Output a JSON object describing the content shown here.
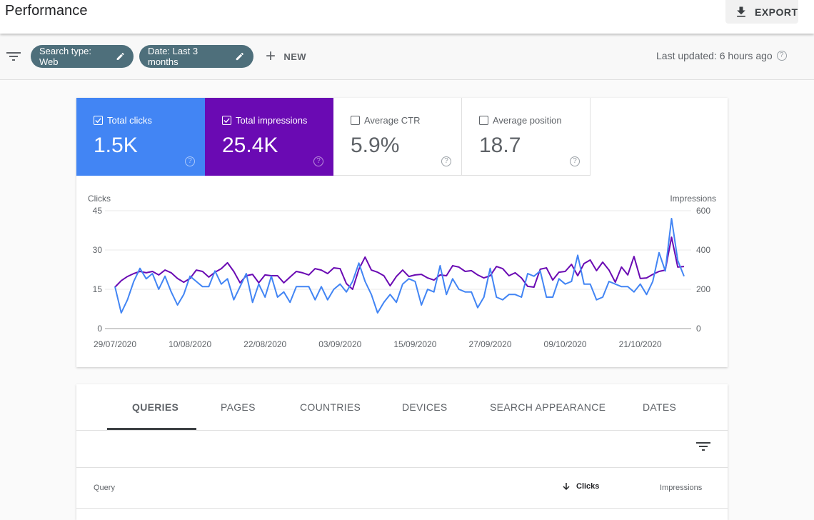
{
  "header": {
    "title": "Performance",
    "export_label": "EXPORT"
  },
  "filters": {
    "chips": [
      {
        "label": "Search type: Web"
      },
      {
        "label": "Date: Last 3 months"
      }
    ],
    "new_label": "NEW",
    "last_updated": "Last updated: 6 hours ago"
  },
  "metrics": [
    {
      "label": "Total clicks",
      "value": "1.5K",
      "checked": true,
      "color": "#4285f4"
    },
    {
      "label": "Total impressions",
      "value": "25.4K",
      "checked": true,
      "color": "#6a0ab3"
    },
    {
      "label": "Average CTR",
      "value": "5.9%",
      "checked": false
    },
    {
      "label": "Average position",
      "value": "18.7",
      "checked": false
    }
  ],
  "chart_data": {
    "type": "line",
    "left_axis_label": "Clicks",
    "right_axis_label": "Impressions",
    "left_ticks": [
      "0",
      "15",
      "30",
      "45"
    ],
    "right_ticks": [
      "0",
      "200",
      "400",
      "600"
    ],
    "left_ylim": [
      0,
      45
    ],
    "right_ylim": [
      0,
      600
    ],
    "x_tick_labels": [
      "29/07/2020",
      "10/08/2020",
      "22/08/2020",
      "03/09/2020",
      "15/09/2020",
      "27/09/2020",
      "09/10/2020",
      "21/10/2020"
    ],
    "x_start": "29/07/2020",
    "x_end": "28/10/2020",
    "grid": true,
    "series": [
      {
        "name": "Clicks",
        "axis": "left",
        "color": "#4285f4",
        "values": [
          16,
          6,
          11,
          18,
          23,
          19,
          21,
          15,
          20,
          14,
          9,
          13,
          20,
          18,
          16,
          16,
          22,
          17,
          19,
          11,
          16,
          21,
          10,
          17,
          12,
          20,
          12,
          14,
          10,
          16,
          16,
          16,
          11,
          16,
          11,
          15,
          17,
          14,
          18,
          25,
          18,
          13,
          6,
          10,
          13,
          10,
          17,
          19,
          18,
          9,
          15,
          14,
          24,
          13,
          19,
          15,
          14,
          14,
          8,
          12,
          23,
          12,
          11,
          13,
          13,
          12,
          21,
          20,
          22,
          12,
          12,
          19,
          17,
          18,
          28,
          17,
          17,
          11,
          12,
          18,
          17,
          16,
          16,
          14,
          17,
          13,
          18,
          29,
          22,
          42,
          26,
          20
        ]
      },
      {
        "name": "Impressions",
        "axis": "right",
        "color": "#6a0ab3",
        "values": [
          211,
          244,
          265,
          280,
          291,
          284,
          291,
          273,
          298,
          284,
          255,
          236,
          255,
          298,
          291,
          262,
          287,
          305,
          335,
          291,
          233,
          269,
          276,
          233,
          273,
          269,
          269,
          233,
          262,
          291,
          284,
          273,
          305,
          298,
          280,
          309,
          305,
          229,
          200,
          302,
          364,
          298,
          287,
          269,
          218,
          265,
          298,
          265,
          273,
          276,
          258,
          247,
          273,
          269,
          320,
          313,
          291,
          295,
          273,
          258,
          269,
          316,
          305,
          269,
          284,
          258,
          215,
          211,
          302,
          309,
          247,
          287,
          291,
          327,
          269,
          331,
          349,
          295,
          338,
          298,
          236,
          313,
          273,
          367,
          255,
          258,
          276,
          291,
          298,
          465,
          313,
          316
        ]
      }
    ]
  },
  "table": {
    "tabs": [
      "QUERIES",
      "PAGES",
      "COUNTRIES",
      "DEVICES",
      "SEARCH APPEARANCE",
      "DATES"
    ],
    "active_tab": "QUERIES",
    "columns": [
      "Query",
      "Clicks",
      "Impressions"
    ],
    "sorted_column": "Clicks"
  }
}
